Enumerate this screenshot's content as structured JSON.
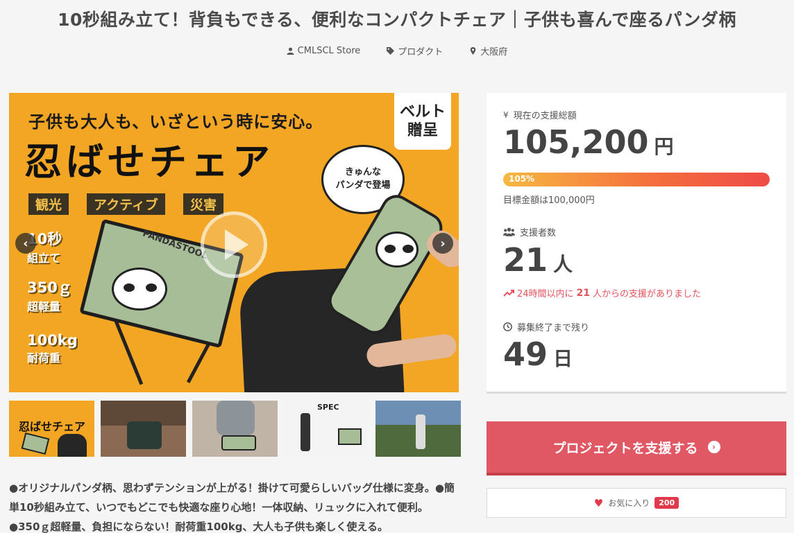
{
  "project": {
    "title": "10秒組み立て！背負もできる、便利なコンパクトチェア｜子供も喜んで座るパンダ柄",
    "owner": "CMLSCL Store",
    "category": "プロダクト",
    "location": "大阪府"
  },
  "hero": {
    "headline_small": "子供も大人も、いざという時に安心。",
    "headline_big": "忍ばせチェア",
    "badge_line1": "ベルト",
    "badge_line2": "贈呈",
    "bubble_line1": "きゅんな",
    "bubble_line2": "パンダで登場",
    "tags": [
      "観光",
      "アクティブ",
      "災害"
    ],
    "spec1_big": "10秒",
    "spec1_small": "組立て",
    "spec2_big": "350ｇ",
    "spec2_small": "超軽量",
    "spec3_big": "100kg",
    "spec3_small": "耐荷重",
    "stool_label": "PANDASTOOL",
    "prev_icon": "chevron-left-icon",
    "next_icon": "chevron-right-icon",
    "play_icon": "play-icon"
  },
  "thumbnails": [
    {
      "name": "thumbnail-1",
      "caption": "忍ばせチェア"
    },
    {
      "name": "thumbnail-2",
      "caption": ""
    },
    {
      "name": "thumbnail-3",
      "caption": ""
    },
    {
      "name": "thumbnail-4",
      "caption": "SPEC"
    },
    {
      "name": "thumbnail-5",
      "caption": ""
    }
  ],
  "description": "●オリジナルパンダ柄、思わずテンションが上がる！掛けて可愛らしいバッグ仕様に変身。●簡単10秒組み立て、いつでもどこでも快適な座り心地！一体収納、リュックに入れて便利。●350ｇ超軽量、負担にならない！耐荷重100kg、大人も子供も楽しく使える。",
  "stats": {
    "total_label": "現在の支援総額",
    "total_value": "105,200",
    "total_unit": "円",
    "progress_percent": 105,
    "progress_label": "105%",
    "goal_text": "目標金額は100,000円",
    "supporters_label": "支援者数",
    "supporters_value": "21",
    "supporters_unit": "人",
    "recent_prefix": "24時間以内に",
    "recent_count": "21",
    "recent_suffix": "人からの支援がありました",
    "remaining_label": "募集終了まで残り",
    "remaining_value": "49",
    "remaining_unit": "日"
  },
  "actions": {
    "support_label": "プロジェクトを支援する",
    "favorite_label": "お気に入り",
    "favorite_count": "200"
  },
  "colors": {
    "accent": "#e05864",
    "hero_bg": "#f2a623",
    "recent_text": "#e5515a"
  }
}
